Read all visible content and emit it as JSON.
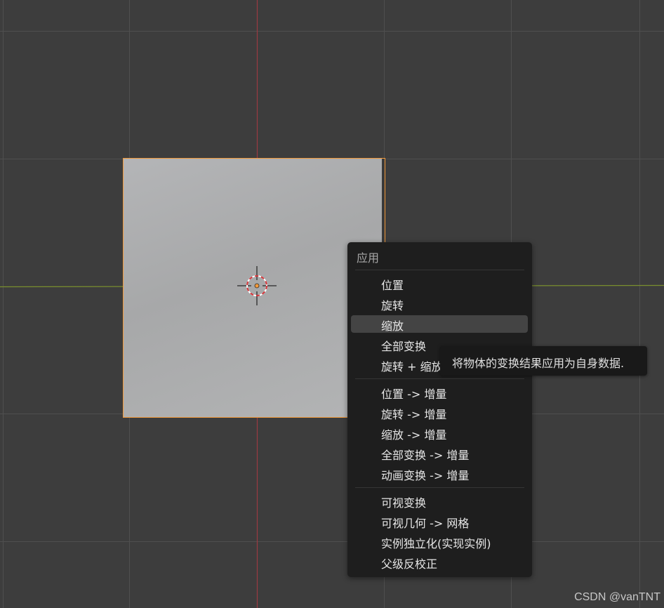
{
  "menu": {
    "title": "应用",
    "items": [
      {
        "label": "位置"
      },
      {
        "label": "旋转"
      },
      {
        "label": "缩放"
      },
      {
        "label": "全部变换"
      },
      {
        "label": "旋转 + 缩放"
      },
      {
        "label": "位置 -> 增量"
      },
      {
        "label": "旋转 -> 增量"
      },
      {
        "label": "缩放 -> 增量"
      },
      {
        "label": "全部变换 -> 增量"
      },
      {
        "label": "动画变换 -> 增量"
      },
      {
        "label": "可视变换"
      },
      {
        "label": "可视几何 -> 网格"
      },
      {
        "label": "实例独立化(实现实例)"
      },
      {
        "label": "父级反校正"
      }
    ],
    "highlighted_item": "缩放"
  },
  "tooltip": {
    "text": "将物体的变换结果应用为自身数据."
  },
  "watermark": "CSDN @vanTNT",
  "colors": {
    "viewport_bg": "#3d3d3d",
    "grid_line": "#4f4f4f",
    "x_axis": "#7a8f2e",
    "y_axis": "#9a3b42",
    "selection_outline": "#f29a3b",
    "menu_bg": "#1e1e1e",
    "menu_highlight": "#444444"
  }
}
